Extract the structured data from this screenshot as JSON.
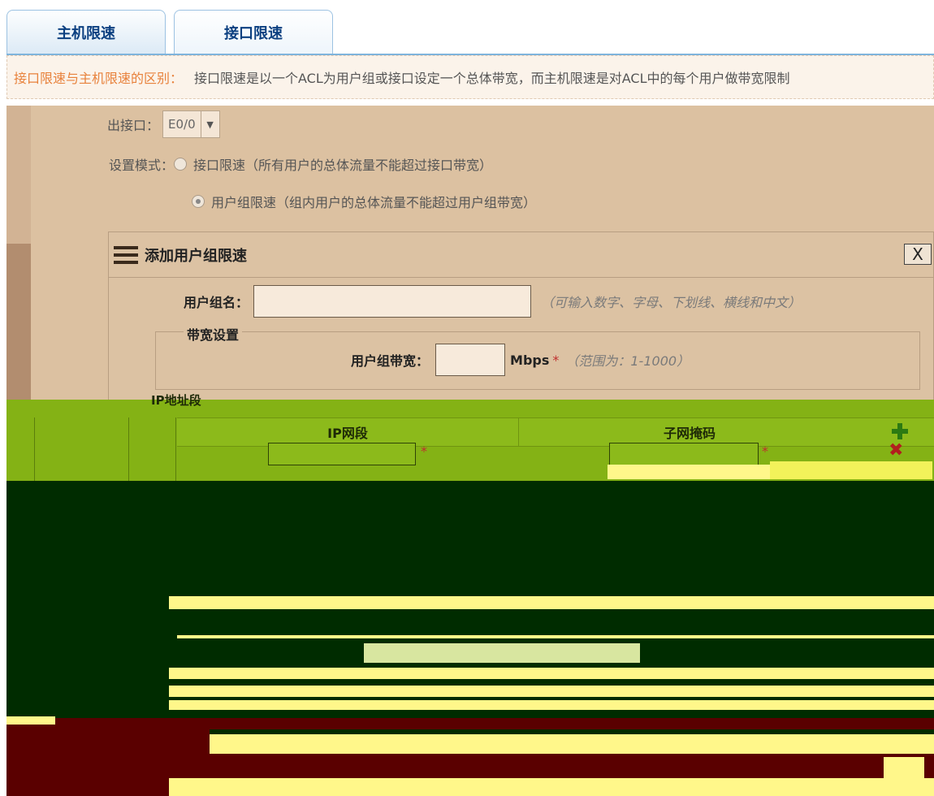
{
  "tabs": [
    {
      "label": "主机限速"
    },
    {
      "label": "接口限速"
    }
  ],
  "note": {
    "label": "接口限速与主机限速的区别：",
    "text": "接口限速是以一个ACL为用户组或接口设定一个总体带宽，而主机限速是对ACL中的每个用户做带宽限制"
  },
  "form": {
    "interface_label": "出接口：",
    "interface_value": "E0/0",
    "mode_label": "设置模式：",
    "mode_options": [
      {
        "label": "接口限速（所有用户的总体流量不能超过接口带宽）",
        "selected": false
      },
      {
        "label": "用户组限速（组内用户的总体流量不能超过用户组带宽）",
        "selected": true
      }
    ]
  },
  "dialog": {
    "title": "添加用户组限速",
    "close": "X",
    "group_name_label": "用户组名：",
    "group_name_value": "",
    "group_name_hint": "（可输入数字、字母、下划线、横线和中文）",
    "bandwidth_legend": "带宽设置",
    "bandwidth_label": "用户组带宽：",
    "bandwidth_value": "",
    "bandwidth_unit": "Mbps",
    "required_mark": "*",
    "bandwidth_hint": "（范围为：1-1000）",
    "ip_section_legend": "IP地址段",
    "table": {
      "headers": [
        "IP网段",
        "子网掩码"
      ],
      "rows": [
        {
          "ip": "",
          "mask": ""
        }
      ]
    }
  },
  "colors": {
    "tab_text": "#0b3f80",
    "note_label": "#e8823c",
    "required": "#c0302f",
    "add_icon": "#2c7a12",
    "delete_icon": "#b21e1e"
  }
}
